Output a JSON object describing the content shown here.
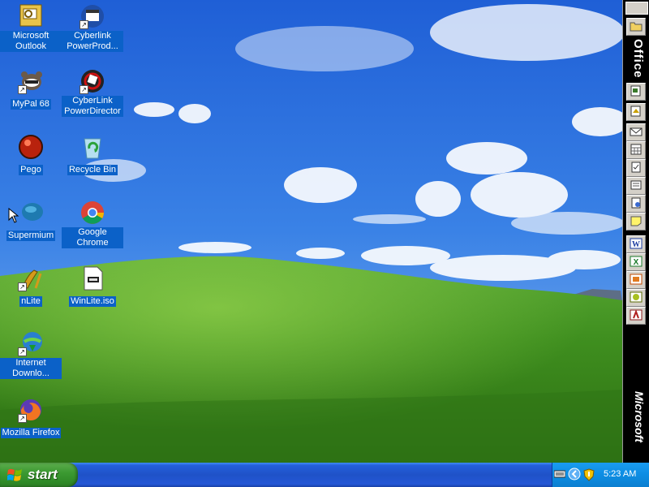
{
  "desktop": {
    "icons": [
      {
        "label": "Microsoft Outlook",
        "icon": "outlook-icon"
      },
      {
        "label": "Cyberlink PowerProd...",
        "icon": "cyberlink-powerproducer-icon"
      },
      {
        "label": "MyPal 68",
        "icon": "mypal-icon"
      },
      {
        "label": "CyberLink PowerDirector",
        "icon": "cyberlink-powerdirector-icon"
      },
      {
        "label": "Pego",
        "icon": "pego-icon"
      },
      {
        "label": "Recycle Bin",
        "icon": "recycle-bin-icon"
      },
      {
        "label": "Supermium",
        "icon": "supermium-icon"
      },
      {
        "label": "Google Chrome",
        "icon": "chrome-icon"
      },
      {
        "label": "nLite",
        "icon": "nlite-icon"
      },
      {
        "label": "WinLite.iso",
        "icon": "iso-file-icon"
      },
      {
        "label": "Internet Downlo...",
        "icon": "internet-download-manager-icon"
      },
      {
        "label": "Mozilla Firefox",
        "icon": "firefox-icon"
      }
    ]
  },
  "office_bar": {
    "title": "Office",
    "brand": "Microsoft",
    "buttons": [
      "office-folder-icon",
      "office-new-doc-icon",
      "office-open-doc-icon",
      "mail-icon",
      "calendar-icon",
      "task-icon",
      "contact-icon",
      "journal-icon",
      "note-icon",
      "word-icon",
      "excel-icon",
      "powerpoint-icon",
      "publisher-icon",
      "access-icon"
    ]
  },
  "taskbar": {
    "start_label": "start",
    "clock": "5:23 AM"
  },
  "colors": {
    "taskbar_blue": "#245edb",
    "start_green": "#3c9a32",
    "tray_blue": "#0d8de3",
    "icon_label_highlight": "#0b61c8"
  }
}
